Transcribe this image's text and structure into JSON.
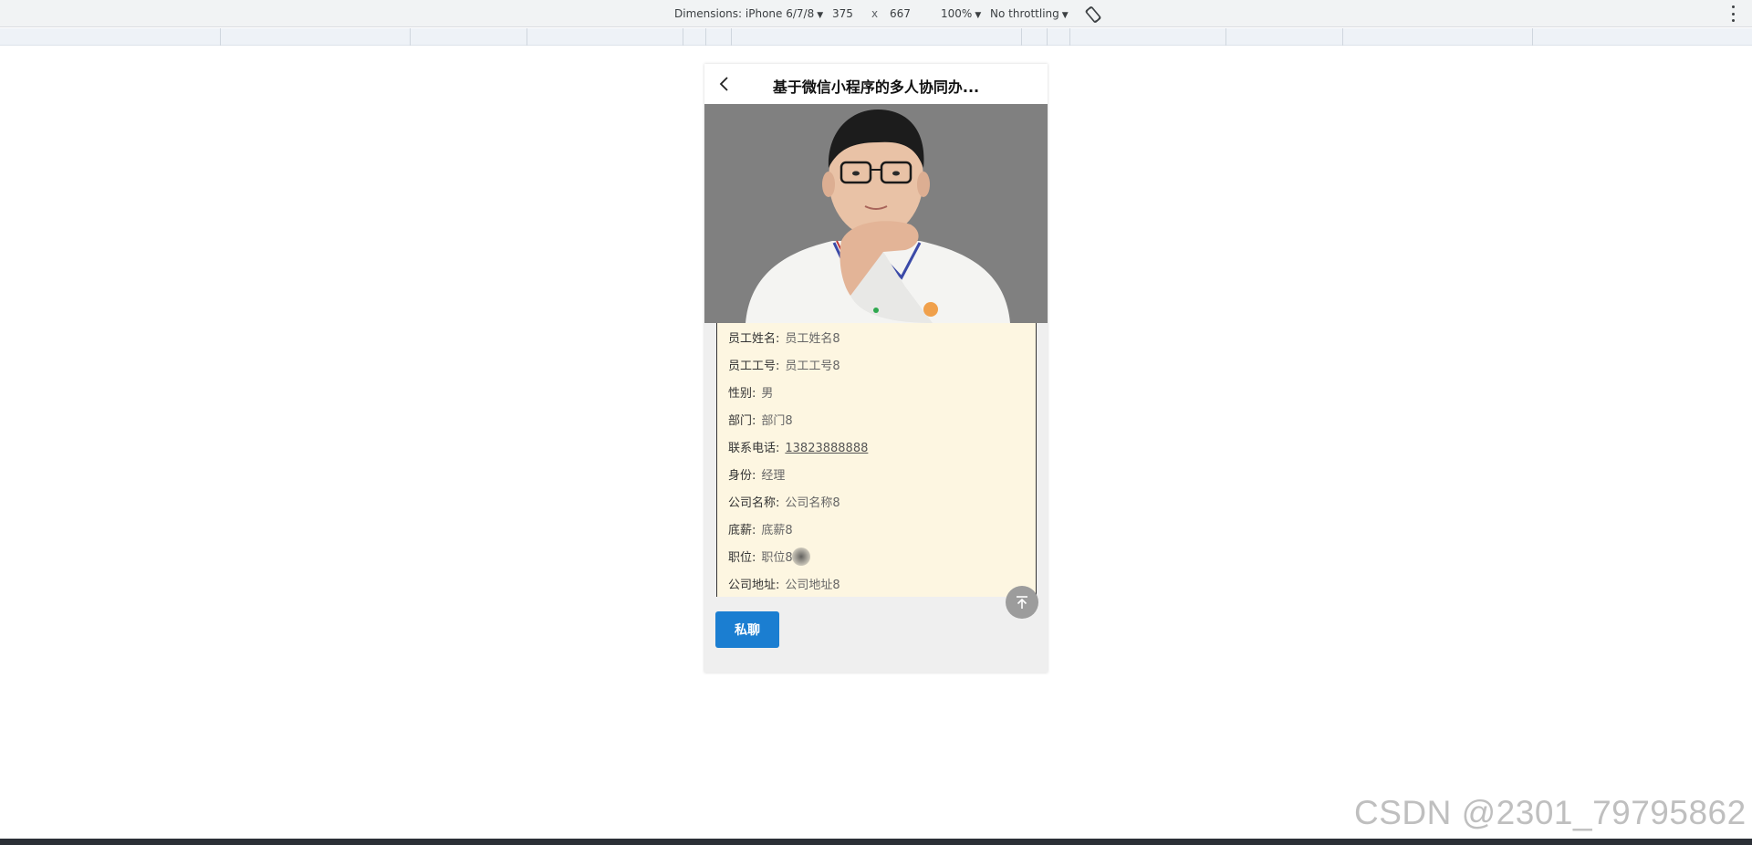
{
  "devtools": {
    "dimensions_label": "Dimensions: iPhone 6/7/8",
    "width": "375",
    "times": "x",
    "height": "667",
    "zoom": "100%",
    "throttling": "No throttling",
    "rotate_icon": "rotate-device-icon",
    "more_icon": "more-vertical-icon"
  },
  "navbar": {
    "back_icon": "chevron-left-icon",
    "title": "基于微信小程序的多人协同办..."
  },
  "profile": {
    "rows": [
      {
        "label": "员工姓名:",
        "value": "员工姓名8"
      },
      {
        "label": "员工工号:",
        "value": "员工工号8"
      },
      {
        "label": "性别:",
        "value": "男"
      },
      {
        "label": "部门:",
        "value": "部门8"
      },
      {
        "label": "联系电话:",
        "value": "13823888888"
      },
      {
        "label": "身份:",
        "value": "经理"
      },
      {
        "label": "公司名称:",
        "value": "公司名称8"
      },
      {
        "label": "底薪:",
        "value": "底薪8"
      },
      {
        "label": "职位:",
        "value": "职位8"
      },
      {
        "label": "公司地址:",
        "value": "公司地址8"
      }
    ]
  },
  "actions": {
    "chat_label": "私聊",
    "to_top_icon": "arrow-up-to-top-icon"
  },
  "colors": {
    "button_blue": "#1b7ed1",
    "panel_bg": "#fdf6e1",
    "photo_bg": "#808080"
  },
  "watermark": "CSDN @2301_79795862"
}
